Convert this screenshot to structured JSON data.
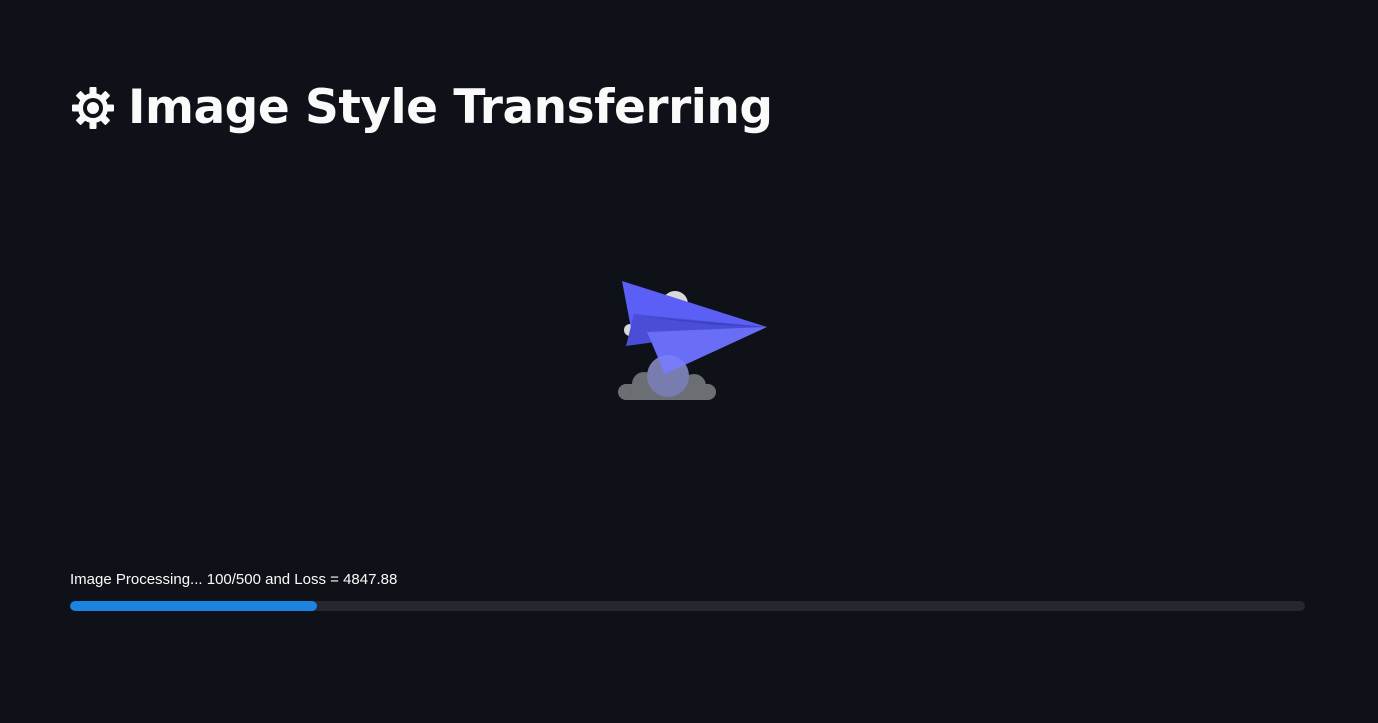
{
  "header": {
    "title": "Image Style Transferring",
    "icon": "gear-icon"
  },
  "loader": {
    "icon": "paper-plane-icon"
  },
  "progress": {
    "status_text": "Image Processing... 100/500 and Loss = 4847.88",
    "fraction": 0.2,
    "color": "#1c83e1",
    "track_color": "#262730"
  },
  "theme": {
    "background": "#0e1117",
    "text": "#fafafa",
    "plane_color": "#5b5ff5",
    "cloud_color": "#6b6e73"
  }
}
